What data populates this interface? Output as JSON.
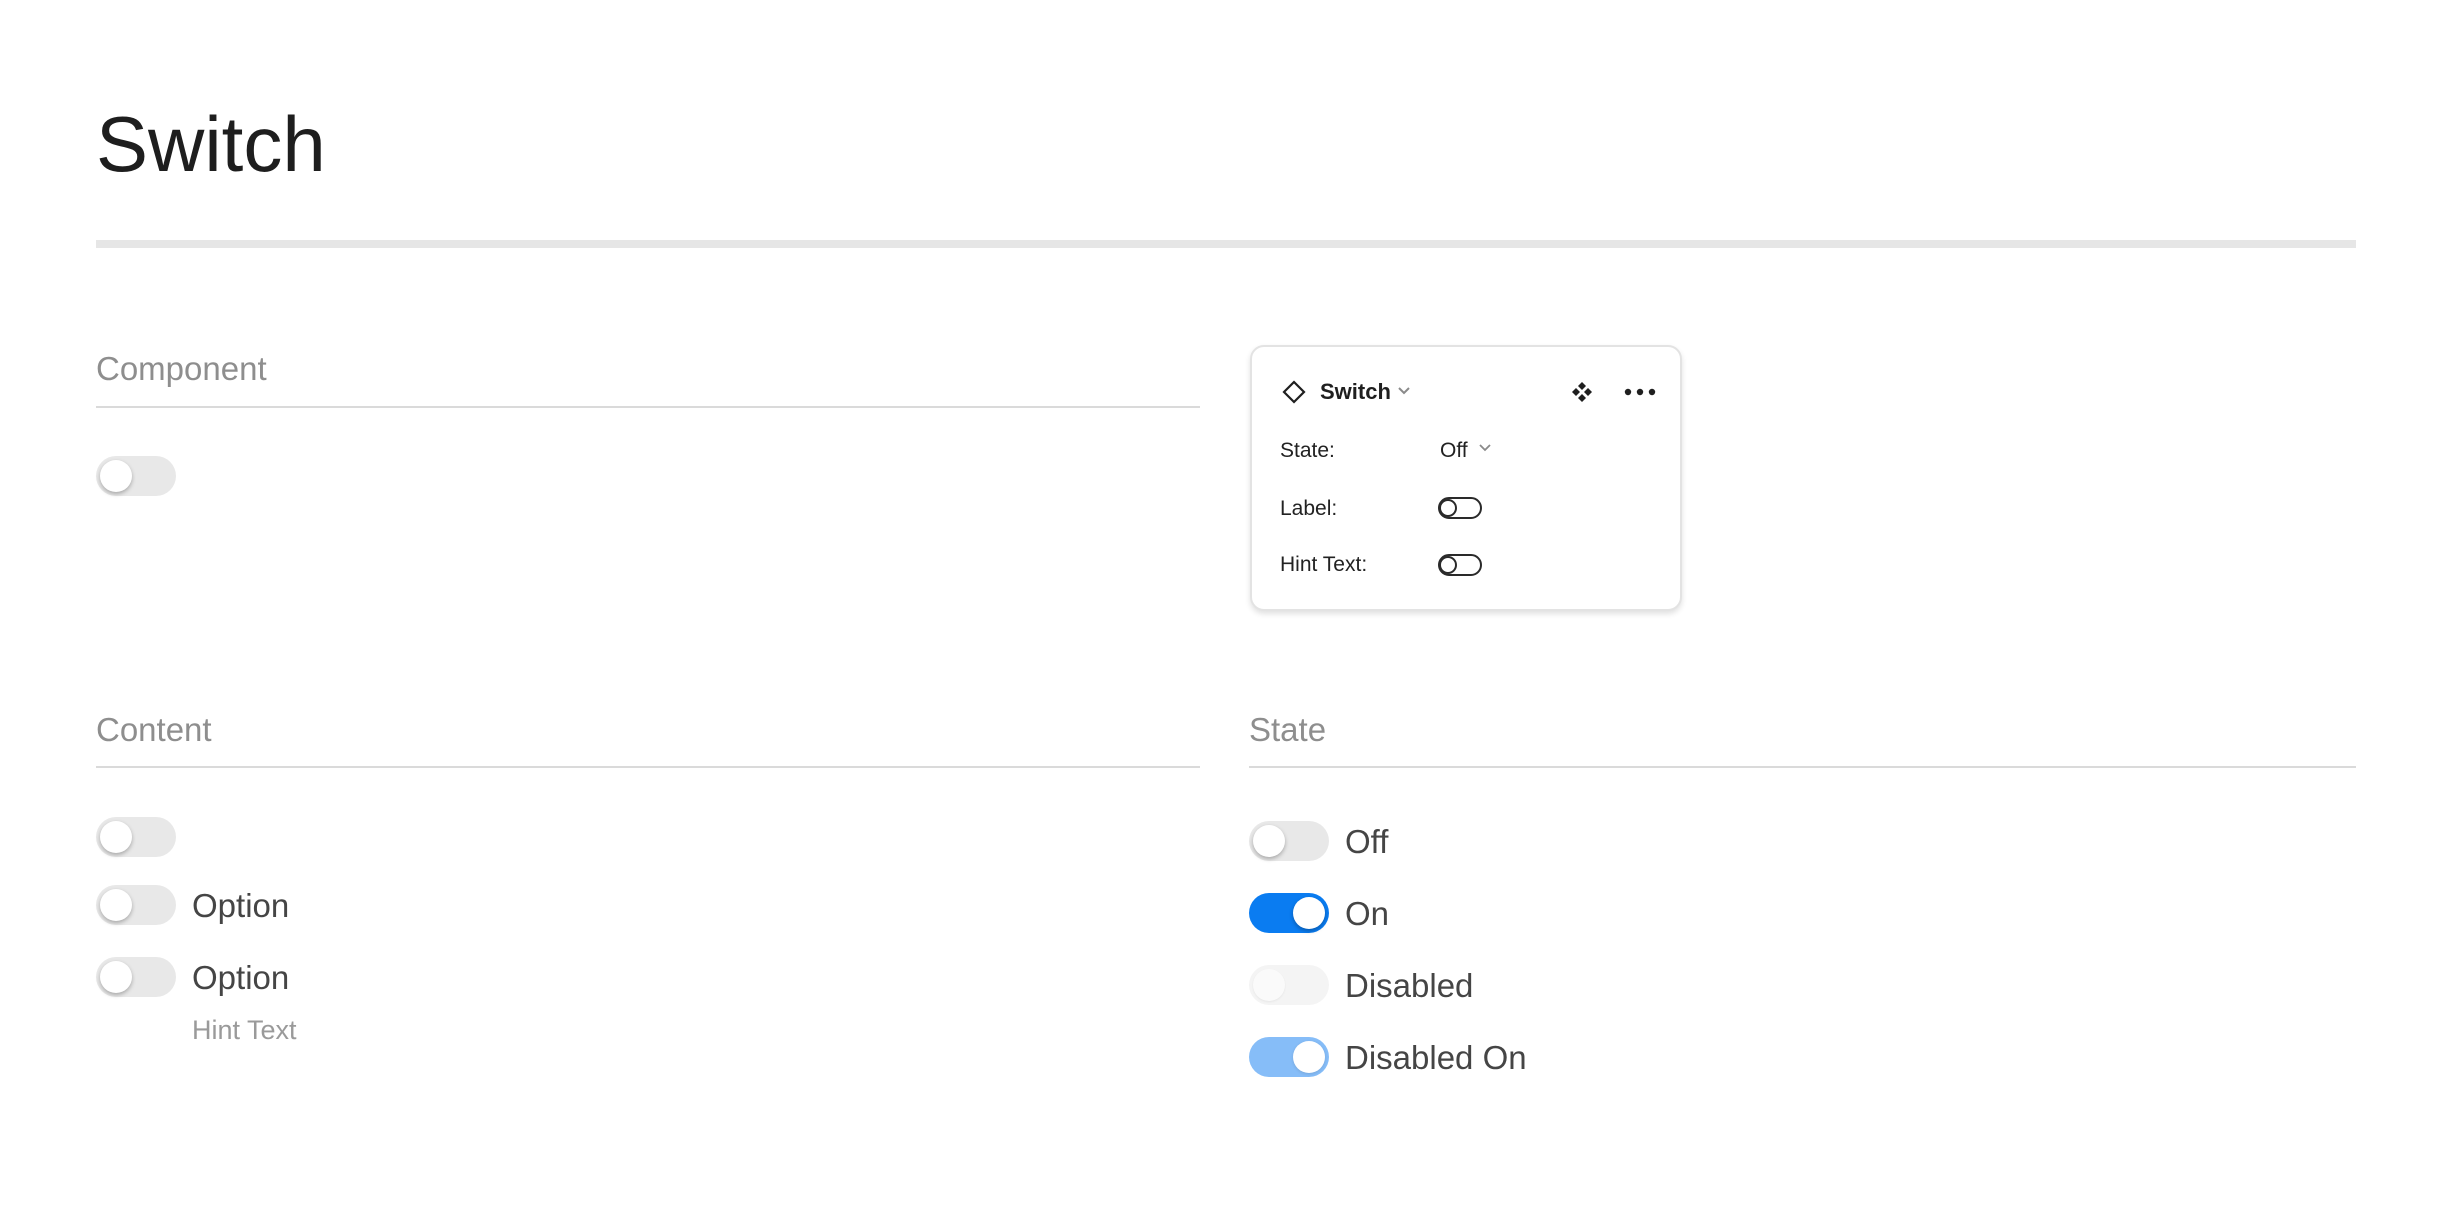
{
  "page": {
    "title": "Switch"
  },
  "sections": {
    "component": "Component",
    "content": "Content",
    "state": "State"
  },
  "panel": {
    "icon": "component-diamond-icon",
    "name": "Switch",
    "props": {
      "state_label": "State:",
      "state_value": "Off",
      "label_label": "Label:",
      "hint_label": "Hint Text:"
    }
  },
  "content": {
    "option_1": "Option",
    "option_2": "Option",
    "hint": "Hint Text"
  },
  "states": {
    "off": "Off",
    "on": "On",
    "disabled": "Disabled",
    "disabled_on": "Disabled On"
  },
  "colors": {
    "accent": "#0a7cf1",
    "accent_disabled": "#86bdf8",
    "track_off": "#e8e8e8"
  }
}
